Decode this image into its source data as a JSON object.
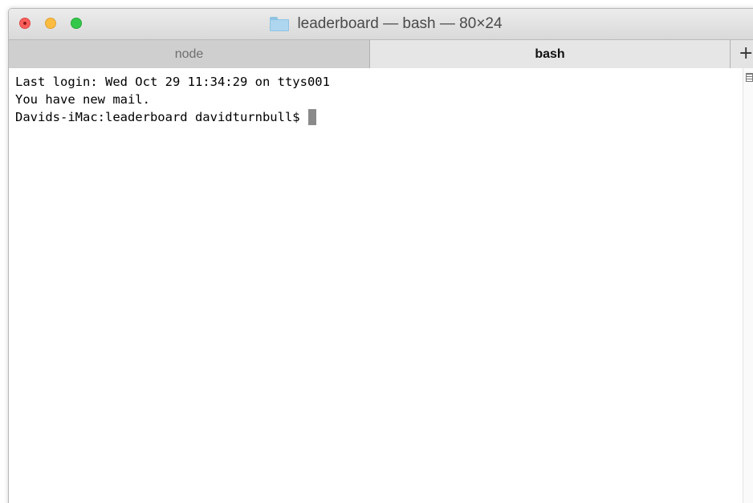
{
  "window": {
    "title": "leaderboard — bash — 80×24"
  },
  "icons": {
    "title_icon": "folder-icon",
    "new_tab": "plus-icon",
    "scroll": "scroll-marks-icon"
  },
  "tabs": [
    {
      "label": "node",
      "active": false
    },
    {
      "label": "bash",
      "active": true
    }
  ],
  "new_tab_label": "+",
  "terminal": {
    "lines": [
      "Last login: Wed Oct 29 11:34:29 on ttys001",
      "You have new mail."
    ],
    "prompt": "Davids-iMac:leaderboard davidturnbull$ "
  },
  "colors": {
    "close": "#fc605c",
    "minimize": "#fdbc40",
    "zoom": "#34c84a",
    "folder": "#aed6ee",
    "cursor": "#8a8a8a"
  }
}
